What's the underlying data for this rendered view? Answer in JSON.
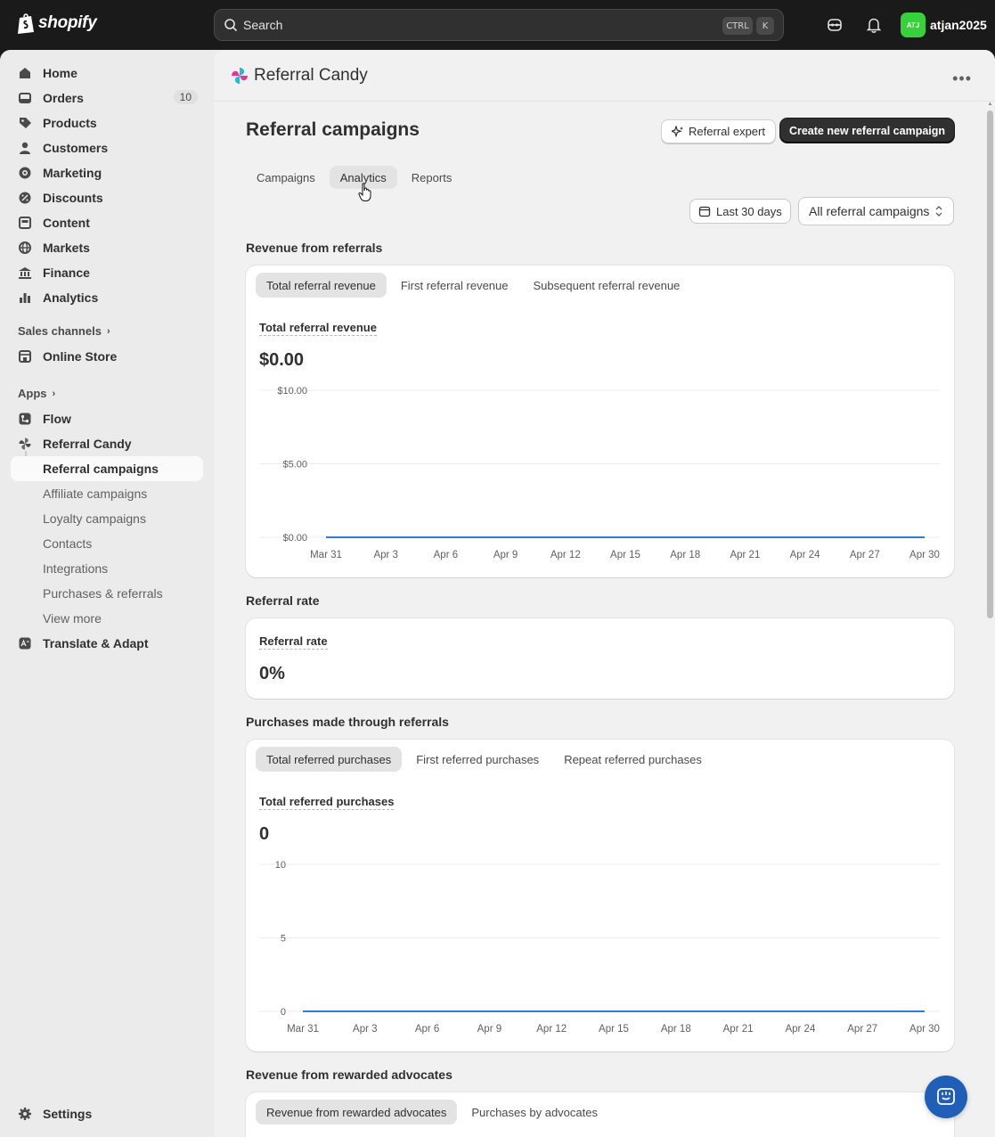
{
  "brand": {
    "name": "shopify"
  },
  "search": {
    "placeholder": "Search",
    "kbd1": "CTRL",
    "kbd2": "K"
  },
  "user": {
    "initials": "ATJ",
    "name": "atjan2025"
  },
  "sidebar": {
    "items": [
      {
        "label": "Home",
        "icon": "home-icon"
      },
      {
        "label": "Orders",
        "icon": "orders-icon",
        "badge": "10"
      },
      {
        "label": "Products",
        "icon": "tag-icon"
      },
      {
        "label": "Customers",
        "icon": "person-icon"
      },
      {
        "label": "Marketing",
        "icon": "target-icon"
      },
      {
        "label": "Discounts",
        "icon": "discount-icon"
      },
      {
        "label": "Content",
        "icon": "content-icon"
      },
      {
        "label": "Markets",
        "icon": "globe-icon"
      },
      {
        "label": "Finance",
        "icon": "bank-icon"
      },
      {
        "label": "Analytics",
        "icon": "bar-chart-icon"
      }
    ],
    "sales_channels_label": "Sales channels",
    "online_store": "Online Store",
    "apps_label": "Apps",
    "flow": "Flow",
    "referral_candy": "Referral Candy",
    "sub_items": [
      "Referral campaigns",
      "Affiliate campaigns",
      "Loyalty campaigns",
      "Contacts",
      "Integrations",
      "Purchases & referrals",
      "View more"
    ],
    "translate": "Translate & Adapt",
    "settings": "Settings"
  },
  "app": {
    "title": "Referral Candy"
  },
  "page": {
    "title": "Referral campaigns",
    "expert_button": "Referral expert",
    "create_button": "Create new referral campaign",
    "tabs": [
      "Campaigns",
      "Analytics",
      "Reports"
    ],
    "date_filter": "Last 30 days",
    "campaign_filter": "All referral campaigns"
  },
  "sections": {
    "revenue": {
      "title": "Revenue from referrals",
      "tabs": [
        "Total referral revenue",
        "First referral revenue",
        "Subsequent referral revenue"
      ],
      "metric_label": "Total referral revenue",
      "metric_value": "$0.00"
    },
    "rate": {
      "title": "Referral rate",
      "metric_label": "Referral rate",
      "metric_value": "0%"
    },
    "purchases": {
      "title": "Purchases made through referrals",
      "tabs": [
        "Total referred purchases",
        "First referred purchases",
        "Repeat referred purchases"
      ],
      "metric_label": "Total referred purchases",
      "metric_value": "0"
    },
    "advocates": {
      "title": "Revenue from rewarded advocates",
      "tabs": [
        "Revenue from rewarded advocates",
        "Purchases by advocates"
      ]
    }
  },
  "chart_data": [
    {
      "type": "line",
      "x": [
        "Mar 31",
        "Apr 3",
        "Apr 6",
        "Apr 9",
        "Apr 12",
        "Apr 15",
        "Apr 18",
        "Apr 21",
        "Apr 24",
        "Apr 27",
        "Apr 30"
      ],
      "series": [
        {
          "values": [
            0,
            0,
            0,
            0,
            0,
            0,
            0,
            0,
            0,
            0,
            0
          ]
        }
      ],
      "y_ticks": [
        "$10.00",
        "$5.00",
        "$0.00"
      ],
      "ylim": [
        0,
        10
      ],
      "color": "#2e7dd6"
    },
    {
      "type": "line",
      "x": [
        "Mar 31",
        "Apr 3",
        "Apr 6",
        "Apr 9",
        "Apr 12",
        "Apr 15",
        "Apr 18",
        "Apr 21",
        "Apr 24",
        "Apr 27",
        "Apr 30"
      ],
      "series": [
        {
          "values": [
            0,
            0,
            0,
            0,
            0,
            0,
            0,
            0,
            0,
            0,
            0
          ]
        }
      ],
      "y_ticks": [
        "10",
        "5",
        "0"
      ],
      "ylim": [
        0,
        10
      ],
      "color": "#2e7dd6"
    }
  ]
}
